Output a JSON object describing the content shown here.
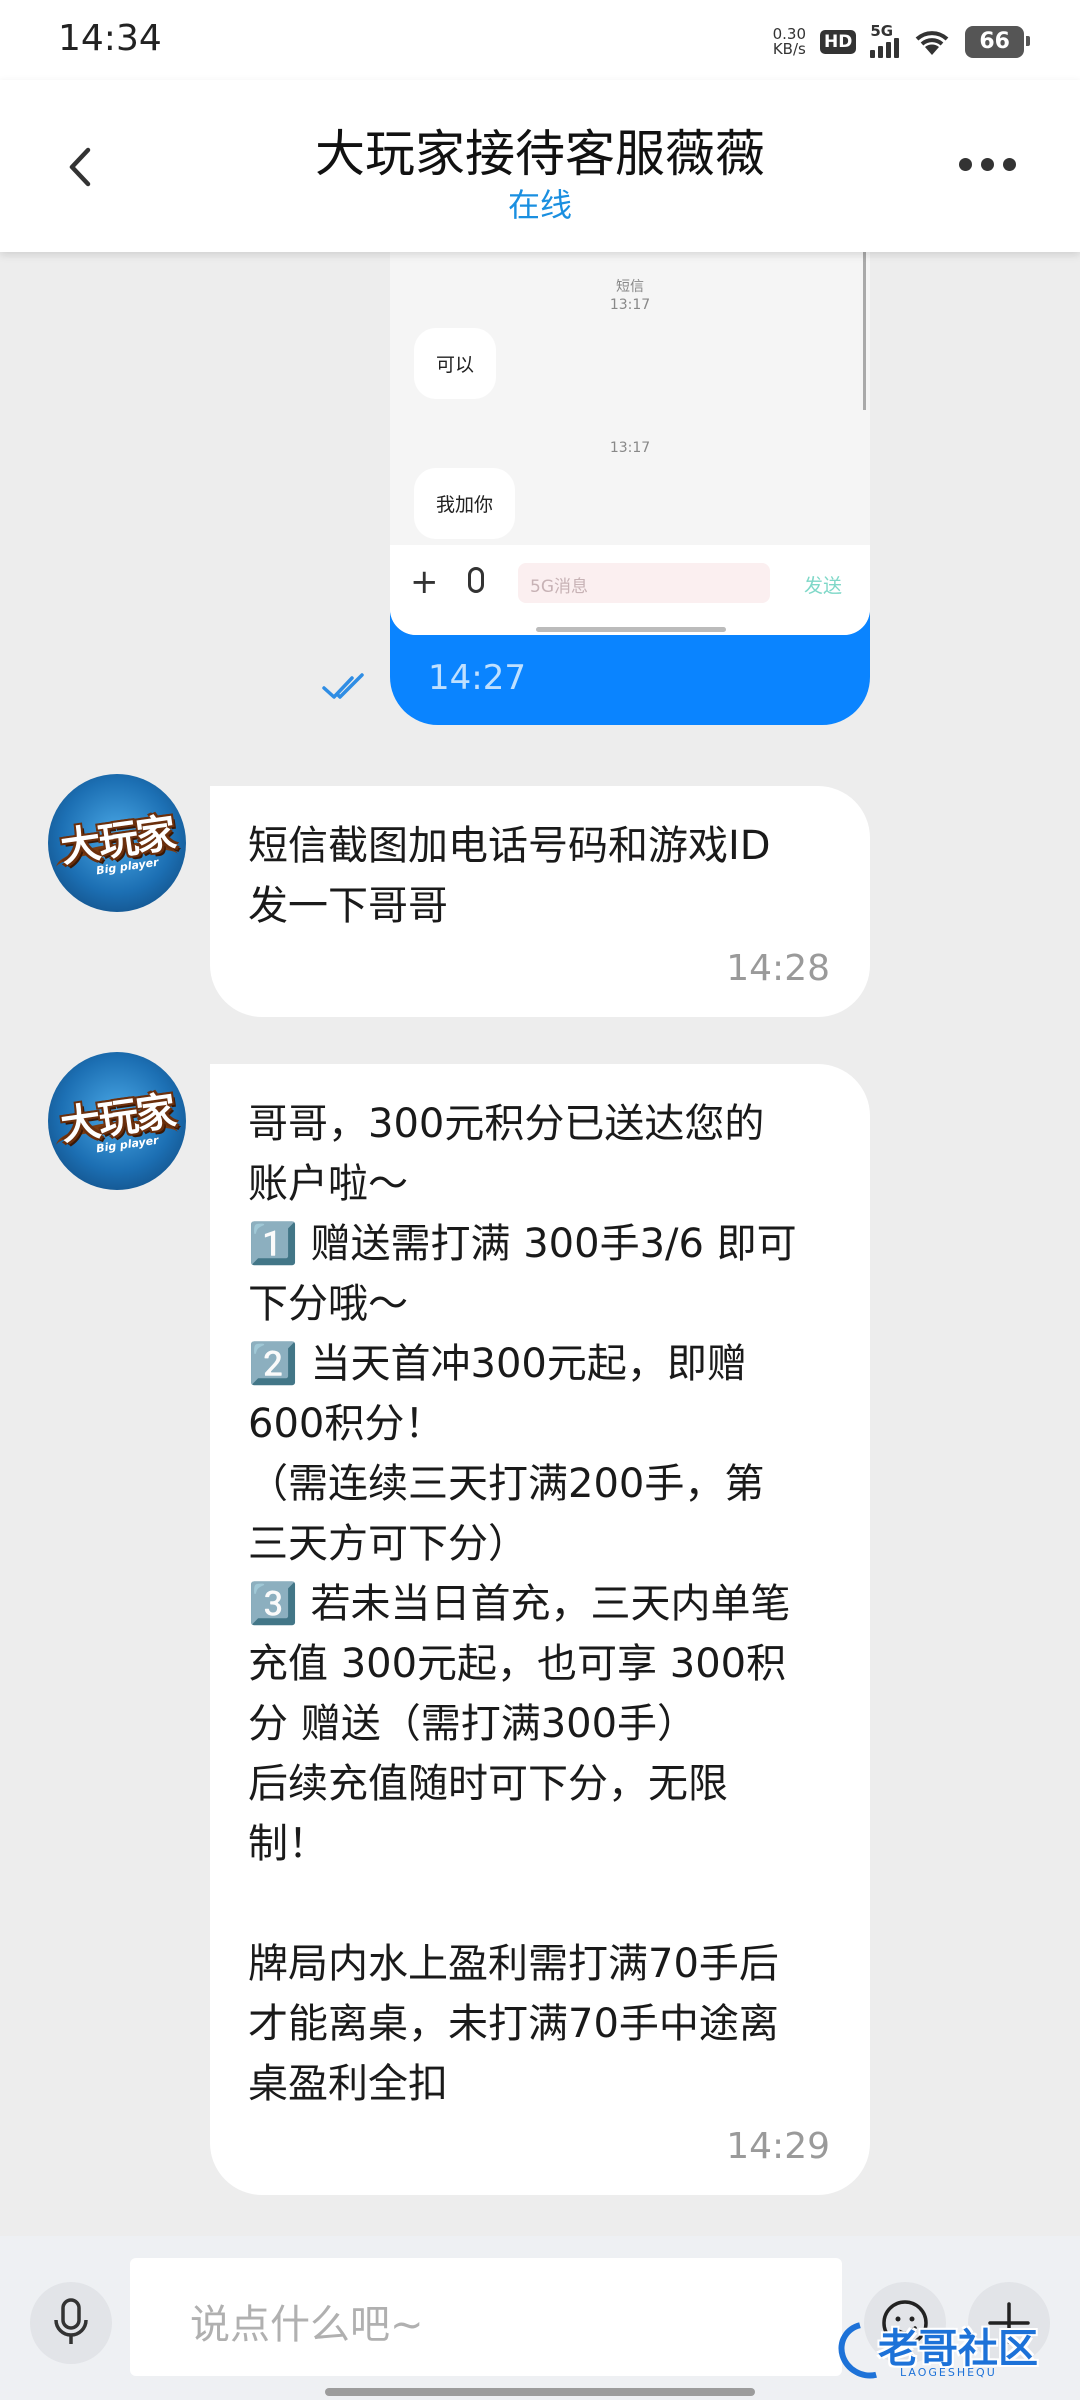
{
  "status_bar": {
    "time": "14:34",
    "net_speed_value": "0.30",
    "net_speed_unit": "KB/s",
    "hd_label": "HD",
    "network_label": "5G",
    "battery": "66"
  },
  "header": {
    "title": "大玩家接待客服薇薇",
    "status": "在线"
  },
  "image_message": {
    "sms_label": "短信",
    "sms_time_1": "13:17",
    "bubble_1": "可以",
    "sms_time_2": "13:17",
    "bubble_2": "我加你",
    "input_placeholder": "5G消息",
    "send_label": "发送",
    "time": "14:27"
  },
  "avatar": {
    "logo_text": "大玩家",
    "logo_sub": "Big player"
  },
  "messages": [
    {
      "text": "短信截图加电话号码和游戏ID\n发一下哥哥",
      "time": "14:28"
    },
    {
      "text": "哥哥，300元积分已送达您的\n账户啦～\n1️⃣ 赠送需打满 300手3/6 即可\n下分哦～\n2️⃣ 当天首冲300元起，即赠\n600积分！\n（需连续三天打满200手，第\n三天方可下分）\n3️⃣ 若未当日首充，三天内单笔\n充值 300元起，也可享 300积\n分 赠送（需打满300手）\n后续充值随时可下分，无限\n制！\n\n牌局内水上盈利需打满70手后\n才能离桌，未打满70手中途离\n桌盈利全扣",
      "time": "14:29"
    }
  ],
  "input": {
    "placeholder": "说点什么吧~"
  },
  "watermark": {
    "text": "老哥社区",
    "sub": "LAOGESHEQU"
  },
  "colors": {
    "accent": "#1a8fe0",
    "image_bubble": "#0a84ff",
    "background": "#ededed"
  }
}
